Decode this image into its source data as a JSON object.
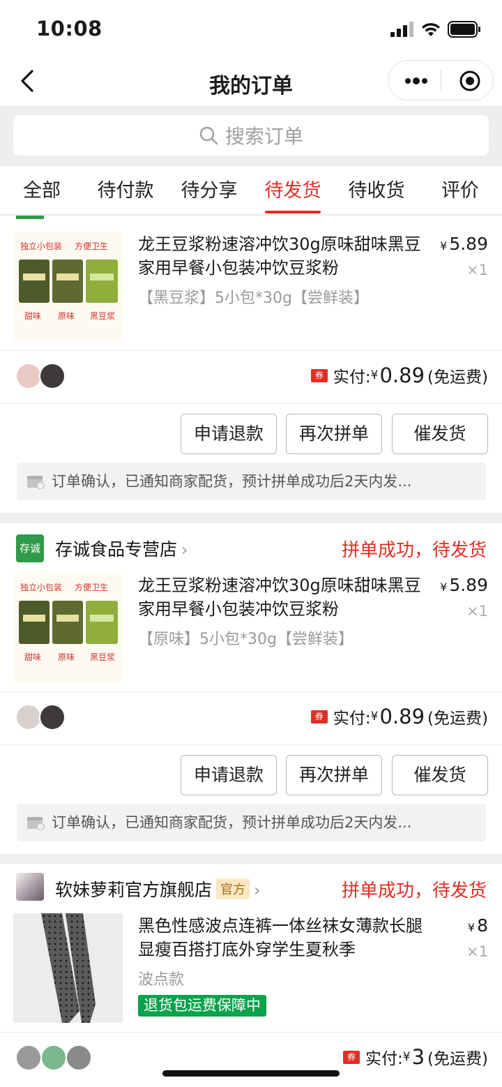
{
  "status_bar": {
    "time": "10:08"
  },
  "nav": {
    "title": "我的订单"
  },
  "search": {
    "placeholder": "搜索订单"
  },
  "tabs": [
    {
      "label": "全部",
      "active": false
    },
    {
      "label": "待付款",
      "active": false
    },
    {
      "label": "待分享",
      "active": false
    },
    {
      "label": "待发货",
      "active": true
    },
    {
      "label": "待收货",
      "active": false
    },
    {
      "label": "评价",
      "active": false
    }
  ],
  "colors": {
    "accent": "#e02e24",
    "green": "#0aa34b"
  },
  "orders": [
    {
      "product": {
        "title": "龙王豆浆粉速溶冲饮30g原味甜味黑豆家用早餐小包装冲饮豆浆粉",
        "spec": "【黑豆浆】5小包*30g【尝鲜装】",
        "price_symbol": "¥",
        "price": "5.89",
        "qty": "×1",
        "img_labels": {
          "top_left": "独立小包装",
          "top_right": "方便卫生",
          "sweet": "甜味",
          "original": "原味",
          "black": "黑豆浆"
        }
      },
      "pay": {
        "coupon": "券",
        "label": "实付:",
        "yen": "¥",
        "amount": "0.89",
        "shipping": "(免运费)"
      },
      "buttons": {
        "refund": "申请退款",
        "regroup": "再次拼单",
        "urge": "催发货"
      },
      "notice": "订单确认，已通知商家配货，预计拼单成功后2天内发..."
    },
    {
      "shop": {
        "logo_text": "存诚",
        "name": "存诚食品专营店",
        "status": "拼单成功，待发货"
      },
      "product": {
        "title": "龙王豆浆粉速溶冲饮30g原味甜味黑豆家用早餐小包装冲饮豆浆粉",
        "spec": "【原味】5小包*30g【尝鲜装】",
        "price_symbol": "¥",
        "price": "5.89",
        "qty": "×1",
        "img_labels": {
          "top_left": "独立小包装",
          "top_right": "方便卫生",
          "sweet": "甜味",
          "original": "原味",
          "black": "黑豆浆"
        }
      },
      "pay": {
        "coupon": "券",
        "label": "实付:",
        "yen": "¥",
        "amount": "0.89",
        "shipping": "(免运费)"
      },
      "buttons": {
        "refund": "申请退款",
        "regroup": "再次拼单",
        "urge": "催发货"
      },
      "notice": "订单确认，已通知商家配货，预计拼单成功后2天内发..."
    },
    {
      "shop": {
        "name": "软妹萝莉官方旗舰店",
        "badge": "官方",
        "status": "拼单成功，待发货"
      },
      "product": {
        "title": "黑色性感波点连裤一体丝袜女薄款长腿显瘦百搭打底外穿学生夏秋季",
        "spec": "波点款",
        "tag": "退货包运费保障中",
        "price_symbol": "¥",
        "price": "8",
        "qty": "×1"
      },
      "pay": {
        "coupon": "券",
        "label": "实付:",
        "yen": "¥",
        "amount": "3",
        "shipping": "(免运费)"
      }
    }
  ]
}
